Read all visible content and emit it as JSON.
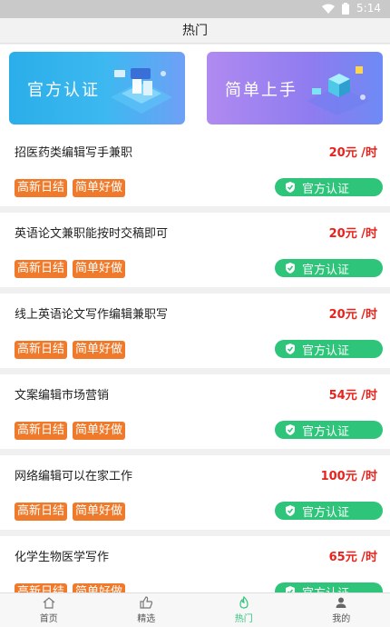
{
  "status": {
    "time": "5:14"
  },
  "header": {
    "title": "热门"
  },
  "banners": [
    {
      "label": "官方认证"
    },
    {
      "label": "简单上手"
    }
  ],
  "jobs": [
    {
      "title": "招医药类编辑写手兼职",
      "salary": "20元 /时"
    },
    {
      "title": "英语论文兼职能按时交稿即可",
      "salary": "20元 /时"
    },
    {
      "title": "线上英语论文写作编辑兼职写",
      "salary": "20元 /时"
    },
    {
      "title": "文案编辑市场营销",
      "salary": "54元 /时"
    },
    {
      "title": "网络编辑可以在家工作",
      "salary": "100元 /时"
    },
    {
      "title": "化学生物医学写作",
      "salary": "65元 /时"
    }
  ],
  "tags": [
    "高新日结",
    "简单好做"
  ],
  "cert_label": "官方认证",
  "tabs": [
    {
      "label": "首页",
      "icon": "home-icon"
    },
    {
      "label": "精选",
      "icon": "thumbs-up-icon"
    },
    {
      "label": "热门",
      "icon": "flame-icon"
    },
    {
      "label": "我的",
      "icon": "user-icon"
    }
  ],
  "colors": {
    "salary": "#e8221d",
    "tag": "#f07a2b",
    "cert": "#2ec47a",
    "active_tab": "#2ec47a"
  }
}
